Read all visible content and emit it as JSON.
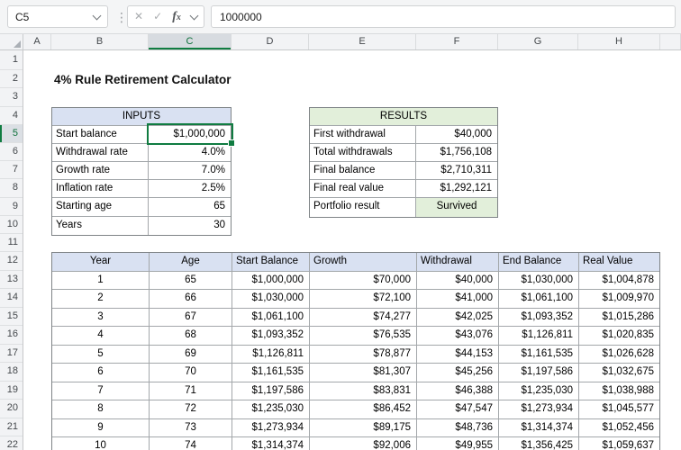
{
  "formula_bar": {
    "name_box": "C5",
    "formula": "1000000",
    "fx_label": "fx"
  },
  "grid": {
    "column_headers": [
      "A",
      "B",
      "C",
      "D",
      "E",
      "F",
      "G",
      "H"
    ],
    "selected_column": "C",
    "row_headers": [
      1,
      2,
      3,
      4,
      5,
      6,
      7,
      8,
      9,
      10,
      11,
      12,
      13,
      14,
      15,
      16,
      17,
      18,
      19,
      20,
      21,
      22
    ],
    "selected_row": 5,
    "selected_cell": "C5"
  },
  "sheet": {
    "title": "4% Rule Retirement Calculator",
    "inputs": {
      "header": "INPUTS",
      "rows": [
        {
          "label": "Start balance",
          "value": "$1,000,000",
          "selected": true
        },
        {
          "label": "Withdrawal rate",
          "value": "4.0%"
        },
        {
          "label": "Growth rate",
          "value": "7.0%"
        },
        {
          "label": "Inflation rate",
          "value": "2.5%"
        },
        {
          "label": "Starting age",
          "value": "65"
        },
        {
          "label": "Years",
          "value": "30"
        }
      ]
    },
    "results": {
      "header": "RESULTS",
      "rows": [
        {
          "label": "First withdrawal",
          "value": "$40,000"
        },
        {
          "label": "Total withdrawals",
          "value": "$1,756,108"
        },
        {
          "label": "Final balance",
          "value": "$2,710,311"
        },
        {
          "label": "Final real value",
          "value": "$1,292,121"
        },
        {
          "label": "Portfolio result",
          "value": "Survived",
          "highlight_value": true
        }
      ]
    },
    "table": {
      "headers": [
        "Year",
        "Age",
        "Start Balance",
        "Growth",
        "Withdrawal",
        "End Balance",
        "Real Value"
      ],
      "rows": [
        [
          "1",
          "65",
          "$1,000,000",
          "$70,000",
          "$40,000",
          "$1,030,000",
          "$1,004,878"
        ],
        [
          "2",
          "66",
          "$1,030,000",
          "$72,100",
          "$41,000",
          "$1,061,100",
          "$1,009,970"
        ],
        [
          "3",
          "67",
          "$1,061,100",
          "$74,277",
          "$42,025",
          "$1,093,352",
          "$1,015,286"
        ],
        [
          "4",
          "68",
          "$1,093,352",
          "$76,535",
          "$43,076",
          "$1,126,811",
          "$1,020,835"
        ],
        [
          "5",
          "69",
          "$1,126,811",
          "$78,877",
          "$44,153",
          "$1,161,535",
          "$1,026,628"
        ],
        [
          "6",
          "70",
          "$1,161,535",
          "$81,307",
          "$45,256",
          "$1,197,586",
          "$1,032,675"
        ],
        [
          "7",
          "71",
          "$1,197,586",
          "$83,831",
          "$46,388",
          "$1,235,030",
          "$1,038,988"
        ],
        [
          "8",
          "72",
          "$1,235,030",
          "$86,452",
          "$47,547",
          "$1,273,934",
          "$1,045,577"
        ],
        [
          "9",
          "73",
          "$1,273,934",
          "$89,175",
          "$48,736",
          "$1,314,374",
          "$1,052,456"
        ],
        [
          "10",
          "74",
          "$1,314,374",
          "$92,006",
          "$49,955",
          "$1,356,425",
          "$1,059,637"
        ]
      ]
    }
  },
  "colors": {
    "accent_green": "#107C41",
    "selected_header_text": "#0E703B",
    "inputs_header_bg": "#D9E1F2",
    "results_header_bg": "#E2EFDA",
    "table_header_bg": "#D9E1F2",
    "survived_bg": "#E2EFDA",
    "border_outer": "#7F8487",
    "border_inner": "#A3A7AA"
  }
}
